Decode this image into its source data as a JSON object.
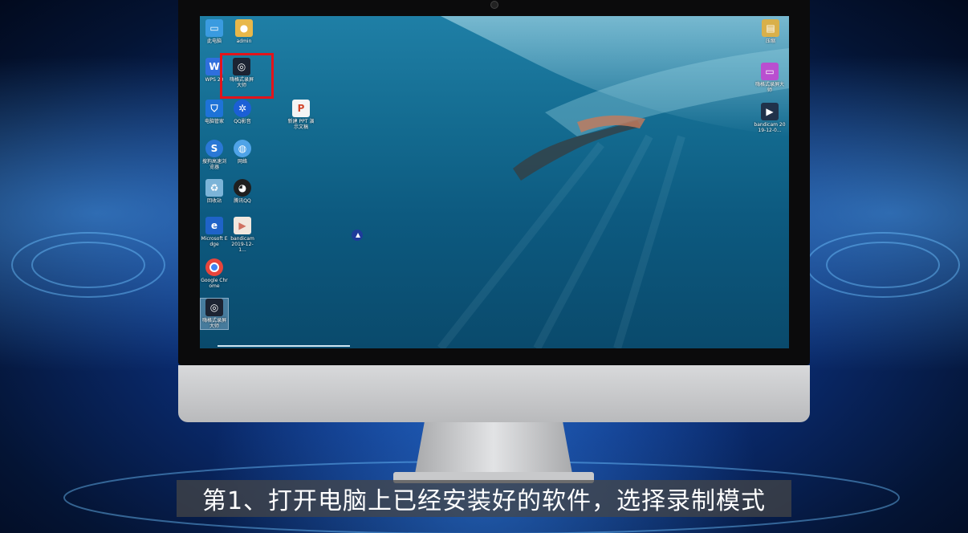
{
  "subtitle": "第1、打开电脑上已经安装好的软件，选择录制模式",
  "colors": {
    "highlight": "#e3141b",
    "desktop": "#136a8f"
  },
  "desktop": {
    "left_icons": [
      {
        "name": "this-pc-icon",
        "label": "此电脑",
        "icon": "computer-icon"
      },
      {
        "name": "admin-folder-icon",
        "label": "admin",
        "icon": "user-folder-icon"
      },
      {
        "name": "wps-icon",
        "label": "WPS 20",
        "icon": "wps-icon"
      },
      {
        "name": "recorder-icon",
        "label": "嗨格式录屏大师",
        "icon": "recorder-icon"
      },
      {
        "name": "pc-manager-icon",
        "label": "电脑管家",
        "icon": "shield-icon"
      },
      {
        "name": "qq-music-icon",
        "label": "QQ影音",
        "icon": "media-player-icon"
      },
      {
        "name": "sogou-browser-icon",
        "label": "搜狗高速浏览器",
        "icon": "browser-icon"
      },
      {
        "name": "network-icon",
        "label": "网络",
        "icon": "network-icon"
      },
      {
        "name": "recycle-bin-icon",
        "label": "回收站",
        "icon": "recycle-bin-icon"
      },
      {
        "name": "tencent-qq-icon",
        "label": "腾讯QQ",
        "icon": "penguin-icon"
      },
      {
        "name": "edge-icon",
        "label": "Microsoft Edge",
        "icon": "edge-icon"
      },
      {
        "name": "bandicam-file-icon",
        "label": "bandicam 2019-12-1...",
        "icon": "video-file-icon"
      },
      {
        "name": "chrome-icon",
        "label": "Google Chrome",
        "icon": "chrome-icon"
      },
      {
        "name": "recorder-selected-icon",
        "label": "嗨格式录屏大师",
        "icon": "recorder-icon"
      }
    ],
    "middle_icons": [
      {
        "name": "ppt-file-icon",
        "label": "新建 PPT 演示文稿",
        "icon": "ppt-icon"
      }
    ],
    "right_icons": [
      {
        "name": "archive-icon",
        "label": "压缩",
        "icon": "archive-icon"
      },
      {
        "name": "remote-icon",
        "label": "嗨格式录屏大师",
        "icon": "app-icon"
      },
      {
        "name": "bandicam-right-icon",
        "label": "bandicam 2019-12-0...",
        "icon": "video-file-icon"
      }
    ]
  }
}
